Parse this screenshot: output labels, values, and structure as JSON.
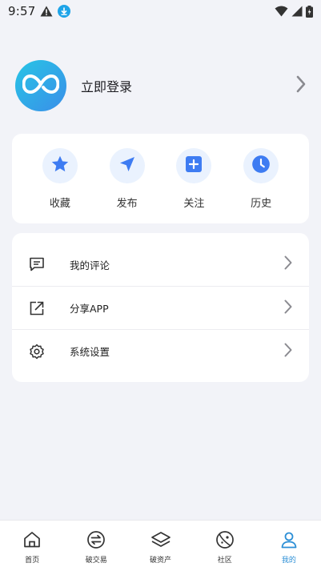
{
  "status_bar": {
    "time": "9:57"
  },
  "profile": {
    "login_label": "立即登录"
  },
  "quick_actions": [
    {
      "label": "收藏",
      "icon": "star-icon"
    },
    {
      "label": "发布",
      "icon": "send-icon"
    },
    {
      "label": "关注",
      "icon": "plus-square-icon"
    },
    {
      "label": "历史",
      "icon": "clock-icon"
    }
  ],
  "menu": [
    {
      "label": "我的评论",
      "icon": "comment-icon"
    },
    {
      "label": "分享APP",
      "icon": "share-icon"
    },
    {
      "label": "系统设置",
      "icon": "gear-icon"
    }
  ],
  "bottom_nav": [
    {
      "label": "首页",
      "icon": "home-icon"
    },
    {
      "label": "破交易",
      "icon": "exchange-icon"
    },
    {
      "label": "破资产",
      "icon": "layers-icon"
    },
    {
      "label": "社区",
      "icon": "planet-icon"
    },
    {
      "label": "我的",
      "icon": "user-icon",
      "active": true
    }
  ],
  "colors": {
    "accent": "#2c8fd6",
    "icon_blue": "#3e7cf2",
    "background": "#f2f3f8"
  }
}
